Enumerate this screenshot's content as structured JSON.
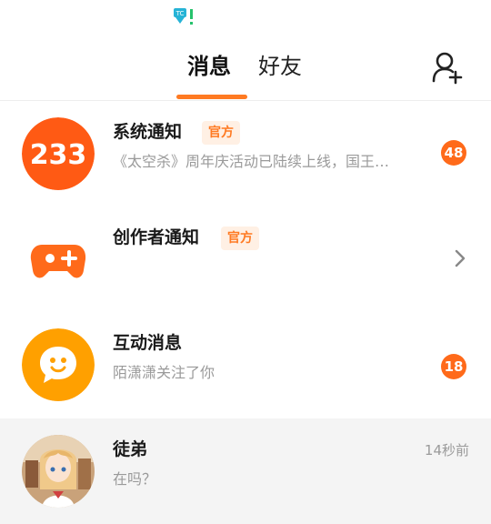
{
  "statusbar": {
    "icon": "notification-download-icon"
  },
  "header": {
    "tabs": [
      {
        "label": "消息"
      },
      {
        "label": "好友"
      }
    ],
    "add_friend_icon": "add-friend-icon"
  },
  "messages": [
    {
      "title": "系统通知",
      "tag": "官方",
      "preview": "《太空杀》周年庆活动已陆续上线，国王…",
      "badge": "48",
      "avatar_text": "233",
      "avatar_color": "#ff5a14"
    },
    {
      "title": "创作者通知",
      "tag": "官方",
      "avatar_icon": "gamepad-icon",
      "avatar_color": "#ff6a1a"
    },
    {
      "title": "互动消息",
      "preview": "陌潇潇关注了你",
      "badge": "18",
      "avatar_icon": "chat-bubble-icon",
      "avatar_color": "#ffa000"
    },
    {
      "title": "徒弟",
      "preview": "在吗？",
      "time": "14秒前",
      "avatar_icon": "user-avatar-photo"
    }
  ],
  "colors": {
    "accent": "#ff7a22",
    "badge": "#ff6a1a",
    "tag_bg": "#fff0e4",
    "highlight_row": "#f4f4f4"
  }
}
